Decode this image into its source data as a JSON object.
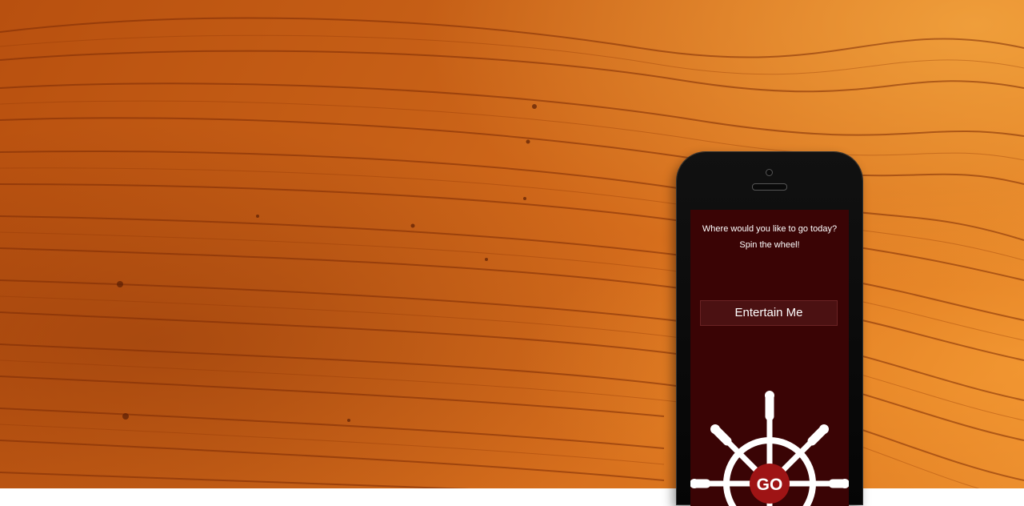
{
  "screen": {
    "prompt_line1": "Where would you like to go today?",
    "prompt_line2": "Spin the wheel!",
    "category_button_label": "Entertain Me",
    "go_label": "GO"
  },
  "colors": {
    "screen_bg": "#3a0405",
    "button_bg": "#4b1112",
    "go_center": "#9e1415",
    "wheel": "#ffffff",
    "wood": "#c65f16"
  },
  "icons": [
    "ship-wheel-icon"
  ]
}
